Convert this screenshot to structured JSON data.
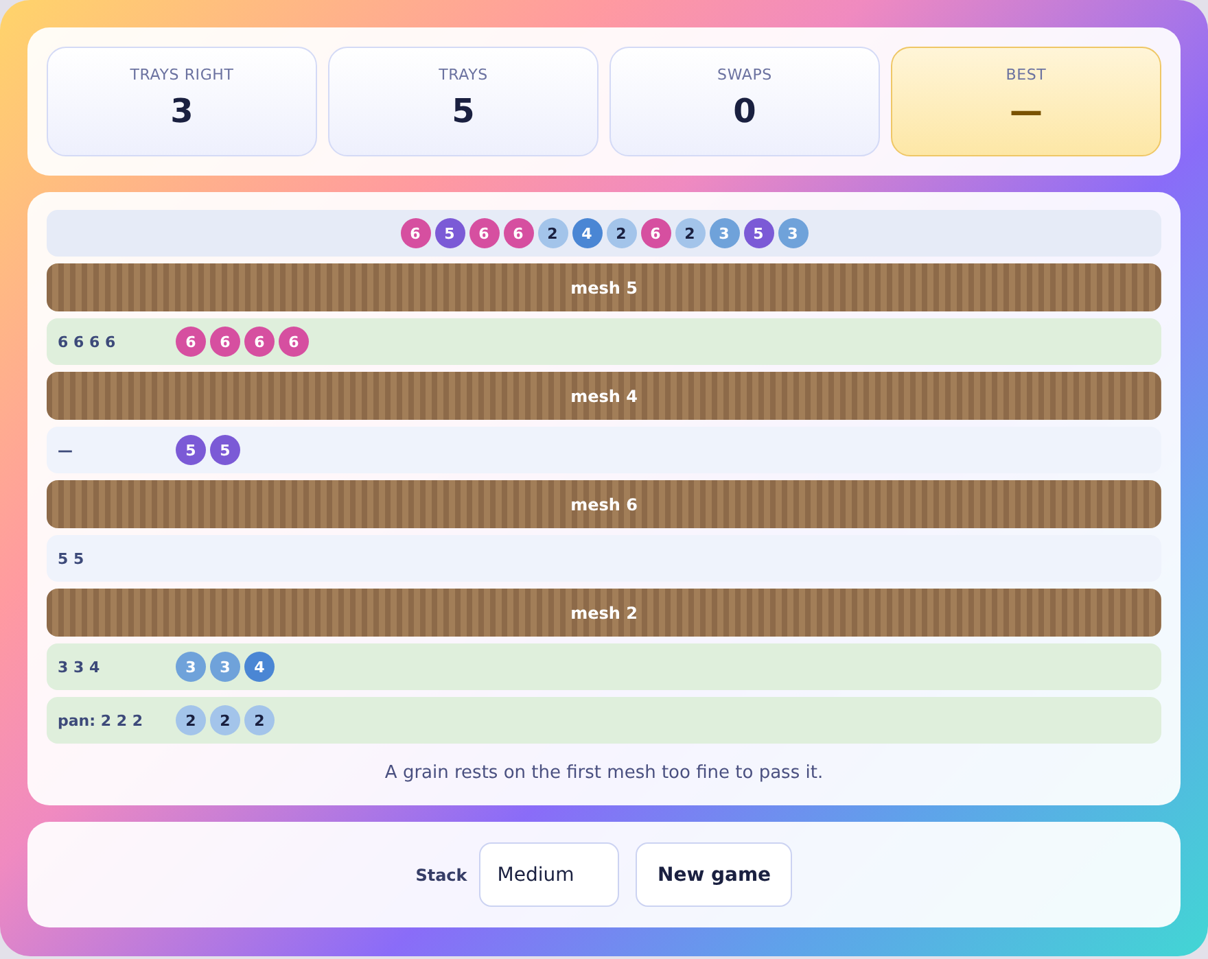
{
  "stats": [
    {
      "label": "TRAYS RIGHT",
      "value": "3",
      "highlight": false
    },
    {
      "label": "TRAYS",
      "value": "5",
      "highlight": false
    },
    {
      "label": "SWAPS",
      "value": "0",
      "highlight": false
    },
    {
      "label": "BEST",
      "value": "—",
      "highlight": true
    }
  ],
  "sieve": {
    "feed": [
      {
        "label": "6",
        "color": "#d64fa0"
      },
      {
        "label": "5",
        "color": "#7b5ad6"
      },
      {
        "label": "6",
        "color": "#d64fa0"
      },
      {
        "label": "6",
        "color": "#d64fa0"
      },
      {
        "label": "2",
        "color": "#a3c4ea"
      },
      {
        "label": "4",
        "color": "#4a86d4"
      },
      {
        "label": "2",
        "color": "#a3c4ea"
      },
      {
        "label": "6",
        "color": "#d64fa0"
      },
      {
        "label": "2",
        "color": "#a3c4ea"
      },
      {
        "label": "3",
        "color": "#6fa2da"
      },
      {
        "label": "5",
        "color": "#7b5ad6"
      },
      {
        "label": "3",
        "color": "#6fa2da"
      }
    ],
    "layers": [
      {
        "kind": "mesh",
        "label": "mesh 5"
      },
      {
        "kind": "tray",
        "label": "6 6 6 6",
        "correct": true,
        "grains": [
          {
            "label": "6",
            "color": "#d64fa0"
          },
          {
            "label": "6",
            "color": "#d64fa0"
          },
          {
            "label": "6",
            "color": "#d64fa0"
          },
          {
            "label": "6",
            "color": "#d64fa0"
          }
        ]
      },
      {
        "kind": "mesh",
        "label": "mesh 4"
      },
      {
        "kind": "tray",
        "label": "—",
        "correct": false,
        "grains": [
          {
            "label": "5",
            "color": "#7b5ad6"
          },
          {
            "label": "5",
            "color": "#7b5ad6"
          }
        ]
      },
      {
        "kind": "mesh",
        "label": "mesh 6"
      },
      {
        "kind": "tray",
        "label": "5 5",
        "correct": false
      },
      {
        "kind": "mesh",
        "label": "mesh 2"
      },
      {
        "kind": "tray",
        "label": "3 3 4",
        "correct": true,
        "grains": [
          {
            "label": "3",
            "color": "#6fa2da"
          },
          {
            "label": "3",
            "color": "#6fa2da"
          },
          {
            "label": "4",
            "color": "#4a86d4"
          }
        ]
      },
      {
        "kind": "tray",
        "label": "pan: 2 2 2",
        "correct": true,
        "grains": [
          {
            "label": "2",
            "color": "#a3c4ea"
          },
          {
            "label": "2",
            "color": "#a3c4ea"
          },
          {
            "label": "2",
            "color": "#a3c4ea"
          }
        ]
      }
    ],
    "message": "A grain rests on the first mesh too fine to pass it."
  },
  "controls": {
    "stack_label": "Stack",
    "stack_value": "Medium",
    "new_game": "New game"
  }
}
